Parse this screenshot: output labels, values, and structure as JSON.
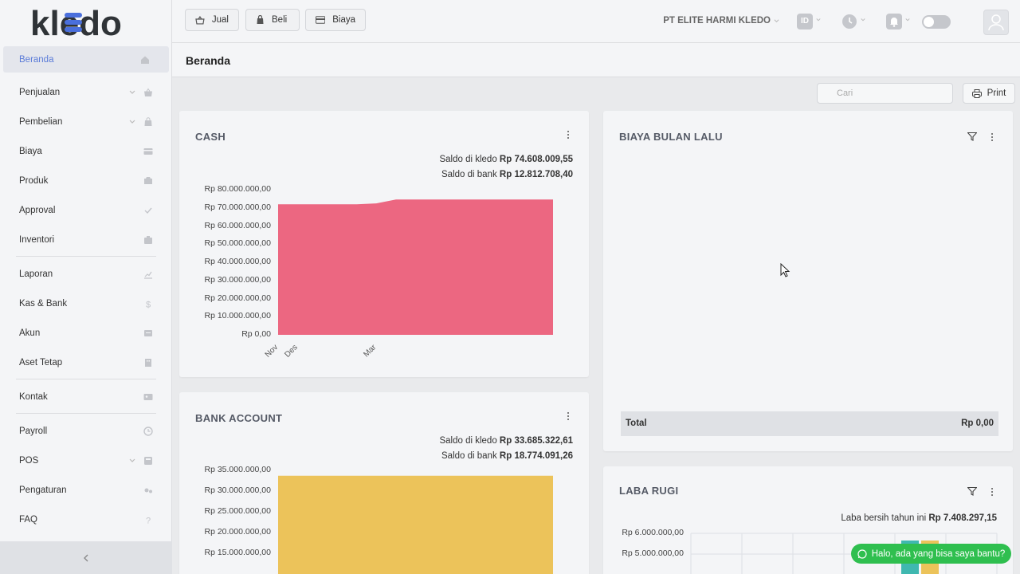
{
  "app": {
    "logo_text": "kledo"
  },
  "sidebar": {
    "items": [
      {
        "label": "Beranda",
        "icon": "home-icon",
        "active": true
      },
      {
        "label": "Penjualan",
        "icon": "basket-icon",
        "chevron": true
      },
      {
        "label": "Pembelian",
        "icon": "bag-icon",
        "chevron": true
      },
      {
        "label": "Biaya",
        "icon": "card-icon"
      },
      {
        "label": "Produk",
        "icon": "box-icon"
      },
      {
        "label": "Approval",
        "icon": "check-icon"
      },
      {
        "label": "Inventori",
        "icon": "inventory-icon"
      },
      {
        "label": "Laporan",
        "icon": "chart-icon"
      },
      {
        "label": "Kas & Bank",
        "icon": "dollar-icon"
      },
      {
        "label": "Akun",
        "icon": "account-icon"
      },
      {
        "label": "Aset Tetap",
        "icon": "building-icon"
      },
      {
        "label": "Kontak",
        "icon": "contact-card-icon"
      },
      {
        "label": "Payroll",
        "icon": "payroll-icon"
      },
      {
        "label": "POS",
        "icon": "pos-icon",
        "chevron": true
      },
      {
        "label": "Pengaturan",
        "icon": "settings-icon"
      },
      {
        "label": "FAQ",
        "icon": "question-icon"
      }
    ],
    "collapse_icon": "chevron-left-icon"
  },
  "topbar": {
    "jual": "Jual",
    "beli": "Beli",
    "biaya": "Biaya",
    "company": "PT ELITE HARMI KLEDO",
    "lang": "ID"
  },
  "page": {
    "title": "Beranda"
  },
  "toolbar": {
    "search_placeholder": "Cari",
    "print": "Print"
  },
  "cash": {
    "title": "CASH",
    "saldo_kledo_label": "Saldo di kledo",
    "saldo_kledo_value": "Rp 74.608.009,55",
    "saldo_bank_label": "Saldo di bank",
    "saldo_bank_value": "Rp 12.812.708,40"
  },
  "bank": {
    "title": "BANK ACCOUNT",
    "saldo_kledo_label": "Saldo di kledo",
    "saldo_kledo_value": "Rp 33.685.322,61",
    "saldo_bank_label": "Saldo di bank",
    "saldo_bank_value": "Rp 18.774.091,26"
  },
  "biaya": {
    "title": "BIAYA BULAN LALU",
    "total_label": "Total",
    "total_value": "Rp 0,00"
  },
  "labarugi": {
    "title": "LABA RUGI",
    "laba_label": "Laba bersih tahun ini",
    "laba_value": "Rp 7.408.297,15"
  },
  "chat": {
    "label": "Halo, ada yang bisa saya bantu?"
  },
  "colors": {
    "cash": "#ec6781",
    "bank": "#ecc35a",
    "accent": "#5a7bd8",
    "whatsapp": "#2fbf4f"
  },
  "chart_data": [
    {
      "type": "area",
      "name": "CASH",
      "x": [
        "Nov",
        "Des",
        "",
        "",
        "",
        "Mar",
        "",
        "",
        "",
        "",
        "",
        "",
        "",
        "",
        ""
      ],
      "x_tick_labels": [
        "Nov",
        "Des",
        "Mar"
      ],
      "y": [
        72000000,
        72000000,
        72000000,
        72000000,
        72000000,
        72500000,
        74608009.55,
        74608009.55,
        74608009.55,
        74608009.55,
        74608009.55,
        74608009.55,
        74608009.55,
        74608009.55,
        74608009.55
      ],
      "ylim": [
        0,
        80000000
      ],
      "y_tick_labels": [
        "Rp 80.000.000,00",
        "Rp 70.000.000,00",
        "Rp 60.000.000,00",
        "Rp 50.000.000,00",
        "Rp 40.000.000,00",
        "Rp 30.000.000,00",
        "Rp 20.000.000,00",
        "Rp 10.000.000,00",
        "Rp 0,00"
      ],
      "grid": false
    },
    {
      "type": "area",
      "name": "BANK ACCOUNT",
      "x": [
        "Nov",
        "Des",
        "",
        "",
        "",
        "Mar",
        "",
        "",
        "",
        "",
        "",
        "",
        "",
        "",
        ""
      ],
      "y": [
        33685322.61,
        33685322.61,
        33685322.61,
        33685322.61,
        33685322.61,
        33685322.61,
        33685322.61,
        33685322.61,
        33685322.61,
        33685322.61,
        33685322.61,
        33685322.61,
        33685322.61,
        33685322.61,
        33685322.61
      ],
      "ylim": [
        10000000,
        35000000
      ],
      "y_tick_labels": [
        "Rp 35.000.000,00",
        "Rp 30.000.000,00",
        "Rp 25.000.000,00",
        "Rp 20.000.000,00",
        "Rp 15.000.000,00"
      ],
      "grid": false
    },
    {
      "type": "bar",
      "name": "LABA RUGI",
      "y_tick_labels": [
        "Rp 6.000.000,00",
        "Rp 5.000.000,00"
      ],
      "grid": true
    }
  ]
}
